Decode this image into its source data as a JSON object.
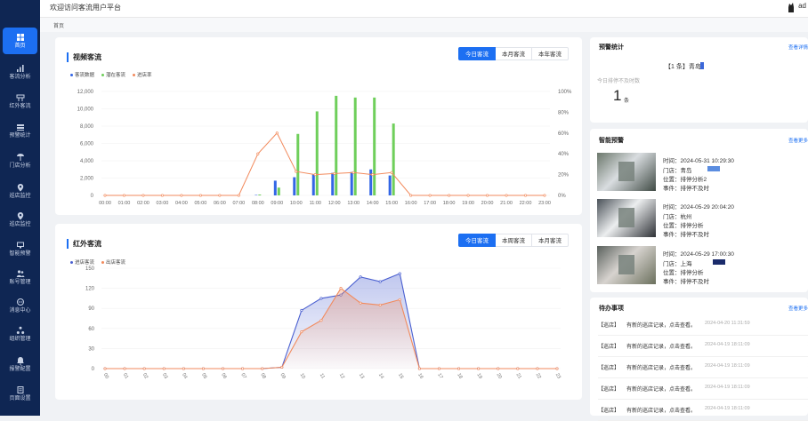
{
  "app": {
    "title": "欢迎访问客流用户平台",
    "user": "ad"
  },
  "breadcrumb": "首页",
  "sidebar": {
    "items": [
      {
        "label": "首页",
        "icon": "home-grid-icon",
        "active": true
      },
      {
        "label": "客流分析",
        "icon": "bar-chart-icon"
      },
      {
        "label": "红外客流",
        "icon": "infrared-icon"
      },
      {
        "label": "预警统计",
        "icon": "statistics-icon"
      },
      {
        "label": "门店分析",
        "icon": "store-icon"
      },
      {
        "label": "巡店监控",
        "icon": "location-pin-icon"
      },
      {
        "label": "巡店监控",
        "icon": "location-pin-icon"
      },
      {
        "label": "智能预警",
        "icon": "monitor-icon"
      },
      {
        "label": "账号管理",
        "icon": "users-icon"
      },
      {
        "label": "消息中心",
        "icon": "message-icon"
      },
      {
        "label": "组织管理",
        "icon": "org-icon"
      },
      {
        "label": "报警配置",
        "icon": "alarm-icon"
      },
      {
        "label": "页面设置",
        "icon": "page-settings-icon"
      }
    ]
  },
  "video_flow": {
    "title": "视频客流",
    "tabs": [
      "今日客流",
      "本月客流",
      "本年客流"
    ],
    "active_tab": 0,
    "legend": [
      "客流数据",
      "潜在客流",
      "进店率"
    ],
    "colors": {
      "customer": "#3366e6",
      "potential": "#6fcf5b",
      "rate": "#f28a5c"
    }
  },
  "infrared_flow": {
    "title": "红外客流",
    "tabs": [
      "今日客流",
      "本周客流",
      "本月客流"
    ],
    "active_tab": 0,
    "legend": [
      "进店客流",
      "出店客流"
    ],
    "colors": {
      "in": "#4a5fd0",
      "out": "#f28a5c"
    }
  },
  "warning_stats": {
    "title": "预警统计",
    "more": "查看详情",
    "item": "【1 条】青岛",
    "subtitle": "今日排停不及时数",
    "count": "1",
    "unit": "条"
  },
  "smart_alerts": {
    "title": "智能预警",
    "more": "查看更多",
    "items": [
      {
        "time": "时间：2024-05-31 10:29:30",
        "store": "门店：青岛",
        "position": "位置：排停分析2",
        "event": "事件：排停不及时"
      },
      {
        "time": "时间：2024-05-29 20:04:20",
        "store": "门店：杭州",
        "position": "位置：排停分析",
        "event": "事件：排停不及时"
      },
      {
        "time": "时间：2024-05-29 17:00:30",
        "store": "门店：上海",
        "position": "位置：排停分析",
        "event": "事件：排停不及时"
      }
    ]
  },
  "todo": {
    "title": "待办事项",
    "more": "查看更多",
    "items": [
      {
        "type": "【巡店】",
        "text": "有新的巡店记录，点击查看。",
        "time": "2024-04-20 11:31:59"
      },
      {
        "type": "【巡店】",
        "text": "有新的巡店记录，点击查看。",
        "time": "2024-04-19 18:11:09"
      },
      {
        "type": "【巡店】",
        "text": "有新的巡店记录，点击查看。",
        "time": "2024-04-19 18:11:09"
      },
      {
        "type": "【巡店】",
        "text": "有新的巡店记录，点击查看。",
        "time": "2024-04-19 18:11:09"
      },
      {
        "type": "【巡店】",
        "text": "有新的巡店记录，点击查看。",
        "time": "2024-04-19 18:11:09"
      }
    ]
  },
  "chart_data": [
    {
      "type": "bar",
      "categories": [
        "00:00",
        "01:00",
        "02:00",
        "03:00",
        "04:00",
        "05:00",
        "06:00",
        "07:00",
        "08:00",
        "09:00",
        "10:00",
        "11:00",
        "12:00",
        "13:00",
        "14:00",
        "15:00",
        "16:00",
        "17:00",
        "18:00",
        "19:00",
        "20:00",
        "21:00",
        "22:00",
        "23:00"
      ],
      "ylim": [
        0,
        12000
      ],
      "yticks": [
        "0",
        "2,000",
        "4,000",
        "6,000",
        "8,000",
        "10,000",
        "12,000"
      ],
      "y2lim": [
        0,
        100
      ],
      "y2ticks": [
        "0%",
        "20%",
        "40%",
        "60%",
        "80%",
        "100%"
      ],
      "series": [
        {
          "name": "客流数据",
          "kind": "bar",
          "values": [
            0,
            0,
            0,
            0,
            0,
            0,
            0,
            0,
            50,
            1700,
            2100,
            2400,
            2600,
            2700,
            3000,
            2300,
            0,
            0,
            0,
            0,
            0,
            0,
            0,
            0
          ]
        },
        {
          "name": "潜在客流",
          "kind": "bar",
          "values": [
            0,
            0,
            0,
            0,
            0,
            0,
            0,
            0,
            100,
            900,
            7100,
            9700,
            11500,
            11300,
            11300,
            8300,
            0,
            0,
            0,
            0,
            0,
            0,
            0,
            0
          ]
        },
        {
          "name": "进店率",
          "kind": "line",
          "axis": "right",
          "values": [
            0,
            0,
            0,
            0,
            0,
            0,
            0,
            0,
            40,
            60,
            23,
            20,
            21,
            22,
            20,
            22,
            0,
            0,
            0,
            0,
            0,
            0,
            0,
            0
          ]
        }
      ]
    },
    {
      "type": "area",
      "categories": [
        "00",
        "01",
        "02",
        "03",
        "04",
        "05",
        "06",
        "07",
        "08",
        "09",
        "10",
        "11",
        "12",
        "13",
        "14",
        "15",
        "16",
        "17",
        "18",
        "19",
        "20",
        "21",
        "22",
        "23"
      ],
      "ylim": [
        0,
        150
      ],
      "yticks": [
        "0",
        "15",
        "30",
        "45",
        "60",
        "75",
        "90",
        "105",
        "120",
        "135",
        "150"
      ],
      "series": [
        {
          "name": "进店客流",
          "values": [
            0,
            0,
            0,
            0,
            0,
            0,
            0,
            0,
            0,
            2,
            87,
            105,
            110,
            137,
            130,
            142,
            0,
            0,
            0,
            0,
            0,
            0,
            0,
            0
          ]
        },
        {
          "name": "出店客流",
          "values": [
            0,
            0,
            0,
            0,
            0,
            0,
            0,
            0,
            0,
            2,
            55,
            72,
            120,
            98,
            95,
            103,
            0,
            0,
            0,
            0,
            0,
            0,
            0,
            0
          ]
        }
      ]
    }
  ]
}
